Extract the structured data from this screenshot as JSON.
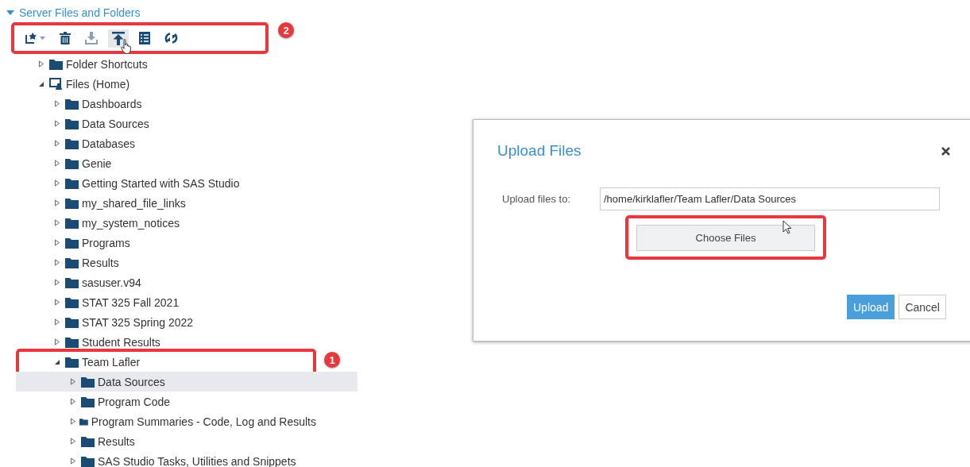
{
  "tree_header": {
    "label": "Server Files and Folders",
    "expanded": true
  },
  "toolbar": {
    "highlighted": true,
    "badge": "2",
    "buttons": [
      {
        "kind": "new",
        "hovered": false
      },
      {
        "kind": "delete",
        "hovered": false
      },
      {
        "kind": "download",
        "hovered": false
      },
      {
        "kind": "upload",
        "hovered": true
      },
      {
        "kind": "properties",
        "hovered": false
      },
      {
        "kind": "refresh",
        "hovered": false
      }
    ]
  },
  "tree": [
    {
      "label": "Folder Shortcuts",
      "kind": "folder",
      "expanded": false,
      "selected": false
    },
    {
      "label": "Files (Home)",
      "kind": "home",
      "expanded": true,
      "selected": false,
      "children": [
        {
          "label": "Dashboards",
          "kind": "folder",
          "expanded": false,
          "selected": false
        },
        {
          "label": "Data Sources",
          "kind": "folder",
          "expanded": false,
          "selected": false
        },
        {
          "label": "Databases",
          "kind": "folder",
          "expanded": false,
          "selected": false
        },
        {
          "label": "Genie",
          "kind": "folder",
          "expanded": false,
          "selected": false
        },
        {
          "label": "Getting Started with SAS Studio",
          "kind": "folder",
          "expanded": false,
          "selected": false
        },
        {
          "label": "my_shared_file_links",
          "kind": "folder",
          "expanded": false,
          "selected": false
        },
        {
          "label": "my_system_notices",
          "kind": "folder",
          "expanded": false,
          "selected": false
        },
        {
          "label": "Programs",
          "kind": "folder",
          "expanded": false,
          "selected": false
        },
        {
          "label": "Results",
          "kind": "folder",
          "expanded": false,
          "selected": false
        },
        {
          "label": "sasuser.v94",
          "kind": "folder",
          "expanded": false,
          "selected": false
        },
        {
          "label": "STAT 325 Fall 2021",
          "kind": "folder",
          "expanded": false,
          "selected": false
        },
        {
          "label": "STAT 325 Spring 2022",
          "kind": "folder",
          "expanded": false,
          "selected": false
        },
        {
          "label": "Student Results",
          "kind": "folder",
          "expanded": false,
          "selected": false
        },
        {
          "label": "Team Lafler",
          "kind": "folder",
          "expanded": true,
          "selected": false,
          "callout": "1",
          "children": [
            {
              "label": "Data Sources",
              "kind": "folder",
              "expanded": false,
              "selected": true
            },
            {
              "label": "Program Code",
              "kind": "folder",
              "expanded": false,
              "selected": false
            },
            {
              "label": "Program Summaries - Code, Log and Results",
              "kind": "folder",
              "expanded": false,
              "selected": false
            },
            {
              "label": "Results",
              "kind": "folder",
              "expanded": false,
              "selected": false
            },
            {
              "label": "SAS Studio Tasks, Utilities and Snippets",
              "kind": "folder",
              "expanded": false,
              "selected": false
            }
          ]
        }
      ]
    }
  ],
  "dialog": {
    "title": "Upload Files",
    "field_label": "Upload files to:",
    "field_value": "/home/kirklafler/Team Lafler/Data Sources",
    "choose_button": {
      "label": "Choose Files",
      "highlighted": true
    },
    "buttons": [
      {
        "label": "Upload",
        "kind": "primary"
      },
      {
        "label": "Cancel",
        "kind": "secondary"
      }
    ]
  }
}
